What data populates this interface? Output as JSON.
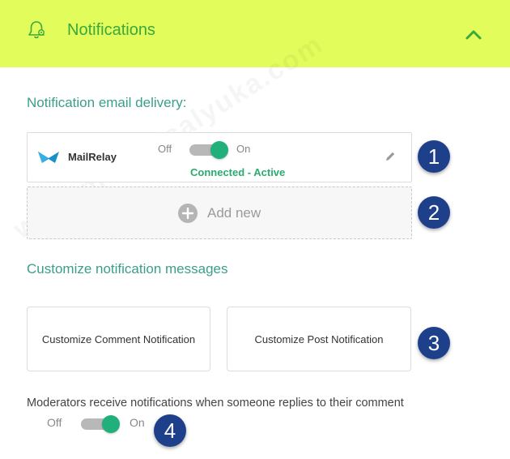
{
  "header": {
    "title": "Notifications",
    "icons": {
      "bell": "bell-gear-icon",
      "collapse": "chevron-up-icon"
    },
    "background": "#e2fc5c",
    "title_color": "#3aa83a"
  },
  "delivery": {
    "section_title": "Notification email delivery:",
    "provider": {
      "name": "MailRelay",
      "icon": "mailrelay-logo",
      "toggle": {
        "off_label": "Off",
        "on_label": "On",
        "state": "on"
      },
      "status": "Connected - Active",
      "edit_icon": "pencil-icon"
    },
    "add_new_label": "Add new"
  },
  "customize": {
    "section_title": "Customize notification messages",
    "buttons": [
      {
        "label": "Customize Comment Notification"
      },
      {
        "label": "Customize Post Notification"
      }
    ]
  },
  "moderators": {
    "text": "Moderators receive notifications when someone replies to their comment",
    "toggle": {
      "off_label": "Off",
      "on_label": "On",
      "state": "on"
    }
  },
  "badges": [
    "1",
    "2",
    "3",
    "4"
  ],
  "colors": {
    "accent": "#21b07c",
    "section_title": "#3b9e8a",
    "badge": "#1e3f8a"
  }
}
